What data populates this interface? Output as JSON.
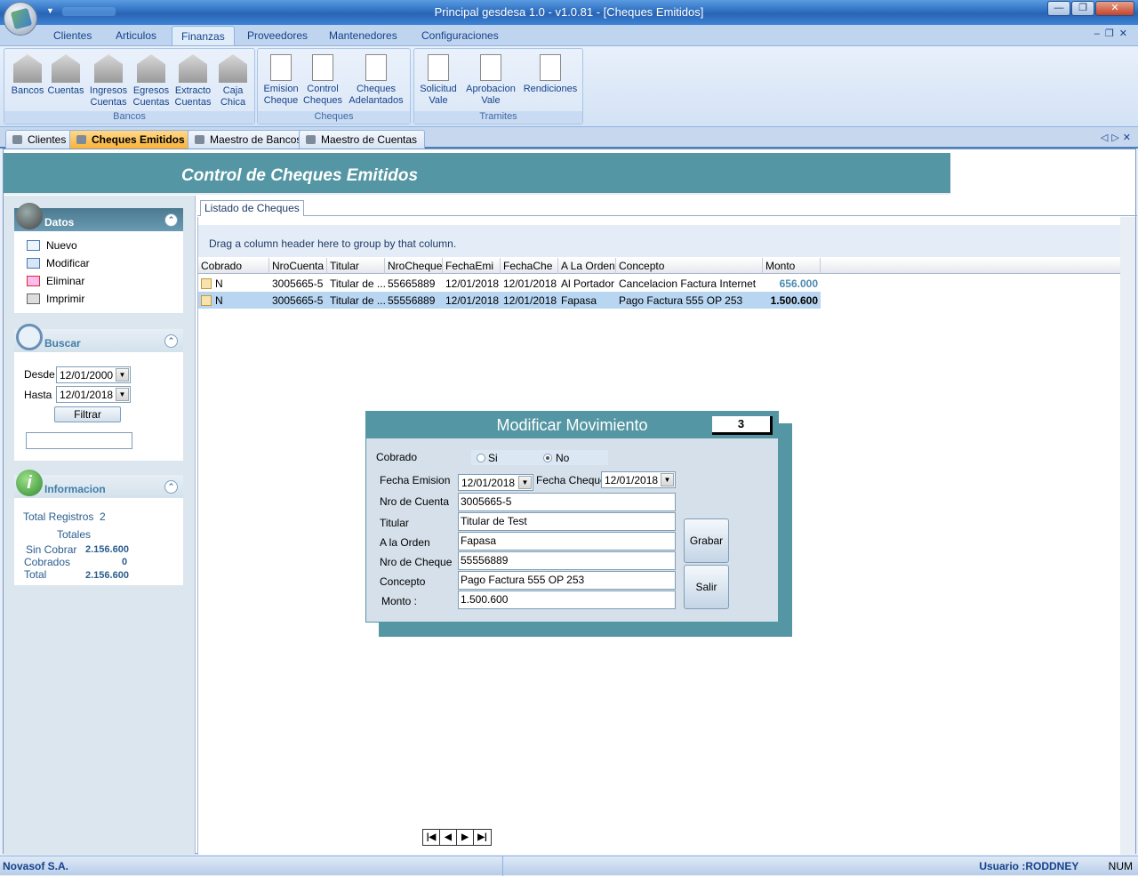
{
  "window": {
    "title": "Principal gesdesa 1.0 - v1.0.81 - [Cheques Emitidos]"
  },
  "ribbon_tabs": [
    "Clientes",
    "Articulos",
    "Finanzas",
    "Proveedores",
    "Mantenedores",
    "Configuraciones"
  ],
  "ribbon": {
    "bancos_group": {
      "label": "Bancos",
      "buttons": [
        [
          "Bancos",
          ""
        ],
        [
          "Cuentas",
          ""
        ],
        [
          "Ingresos",
          "Cuentas"
        ],
        [
          "Egresos",
          "Cuentas"
        ],
        [
          "Extracto",
          "Cuentas"
        ],
        [
          "Caja",
          "Chica"
        ]
      ]
    },
    "cheques_group": {
      "label": "Cheques",
      "buttons": [
        [
          "Emision",
          "Cheque"
        ],
        [
          "Control",
          "Cheques"
        ],
        [
          "Cheques",
          "Adelantados"
        ]
      ]
    },
    "tramites_group": {
      "label": "Tramites",
      "buttons": [
        [
          "Solicitud",
          "Vale"
        ],
        [
          "Aprobacion",
          "Vale"
        ],
        [
          "Rendiciones",
          ""
        ]
      ]
    }
  },
  "doc_tabs": [
    "Clientes",
    "Cheques Emitidos",
    "Maestro de Bancos",
    "Maestro de Cuentas"
  ],
  "page_title": "Control de Cheques Emitidos",
  "datos_panel": {
    "title": "Datos",
    "items": [
      "Nuevo",
      "Modificar",
      "Eliminar",
      "Imprimir"
    ]
  },
  "buscar_panel": {
    "title": "Buscar",
    "desde_label": "Desde",
    "desde": "12/01/2000",
    "hasta_label": "Hasta",
    "hasta": "12/01/2018",
    "filtrar": "Filtrar",
    "search_value": ""
  },
  "info_panel": {
    "title": "Informacion",
    "total_registros_label": "Total Registros",
    "total_registros": "2",
    "totales_label": "Totales",
    "sin_cobrar_label": "Sin Cobrar",
    "sin_cobrar": "2.156.600",
    "cobrados_label": "Cobrados",
    "cobrados": "0",
    "total_label": "Total",
    "total": "2.156.600"
  },
  "listado_tab": "Listado de Cheques",
  "group_hint": "Drag a column header here to group by that column.",
  "grid": {
    "columns": [
      "Cobrado",
      "NroCuenta",
      "Titular",
      "NroCheque",
      "FechaEmi",
      "FechaChe",
      "A La Orden",
      "Concepto",
      "Monto"
    ],
    "rows": [
      [
        "N",
        "3005665-5",
        "Titular de ...",
        "55665889",
        "12/01/2018",
        "12/01/2018",
        "Al Portador",
        "Cancelacion Factura Internet",
        "656.000"
      ],
      [
        "N",
        "3005665-5",
        "Titular de ...",
        "55556889",
        "12/01/2018",
        "12/01/2018",
        "Fapasa",
        "Pago Factura 555 OP 253",
        "1.500.600"
      ]
    ]
  },
  "dialog": {
    "title": "Modificar Movimiento",
    "number": "3",
    "cobrado_label": "Cobrado",
    "si": "Si",
    "no": "No",
    "fecha_emision_label": "Fecha Emision",
    "fecha_emision": "12/01/2018",
    "fecha_cheque_label": "Fecha Cheque",
    "fecha_cheque": "12/01/2018",
    "nro_cuenta_label": "Nro de Cuenta",
    "nro_cuenta": "3005665-5",
    "titular_label": "Titular",
    "titular": "Titular de Test",
    "orden_label": "A la Orden",
    "orden": "Fapasa",
    "nro_cheque_label": "Nro de Cheque",
    "nro_cheque": "55556889",
    "concepto_label": "Concepto",
    "concepto": "Pago Factura 555 OP 253",
    "monto_label": "Monto :",
    "monto": "1.500.600",
    "grabar": "Grabar",
    "salir": "Salir"
  },
  "status": {
    "company": "Novasof S.A.",
    "usuario": "Usuario :RODDNEY",
    "num": "NUM"
  },
  "colors": {
    "accent": "#5496a3",
    "ribbon_text": "#15428b",
    "selected_row": "#b8d6f2"
  }
}
